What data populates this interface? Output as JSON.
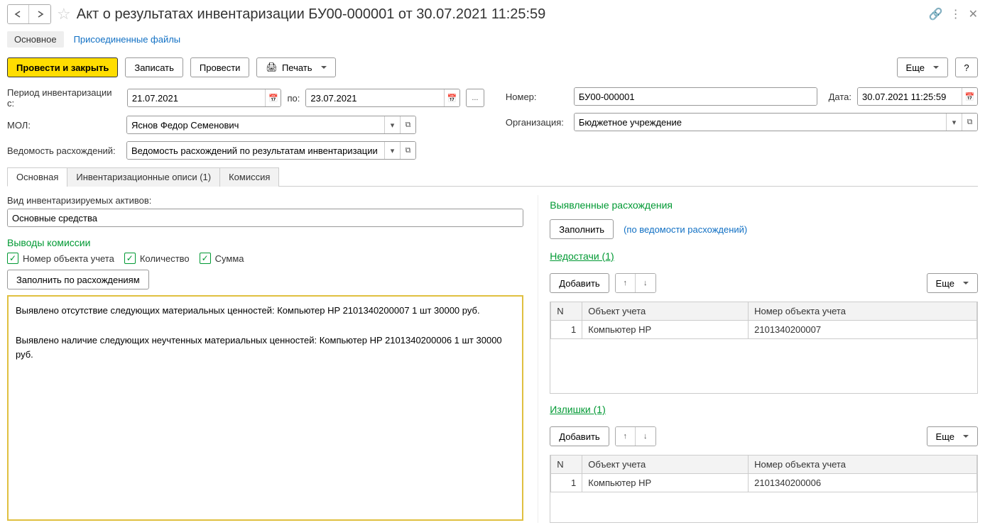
{
  "titlebar": {
    "title": "Акт о результатах инвентаризации БУ00-000001 от 30.07.2021 11:25:59"
  },
  "sections": {
    "main": "Основное",
    "attached": "Присоединенные файлы"
  },
  "toolbar": {
    "post_close": "Провести и закрыть",
    "save": "Записать",
    "post": "Провести",
    "print": "Печать",
    "more": "Еще",
    "help": "?"
  },
  "form": {
    "period_label": "Период инвентаризации с:",
    "period_from": "21.07.2021",
    "period_to_label": "по:",
    "period_to": "23.07.2021",
    "ellipsis": "...",
    "number_label": "Номер:",
    "number": "БУ00-000001",
    "date_label": "Дата:",
    "date": "30.07.2021 11:25:59",
    "mol_label": "МОЛ:",
    "mol": "Яснов Федор Семенович",
    "org_label": "Организация:",
    "org": "Бюджетное учреждение",
    "ved_label": "Ведомость расхождений:",
    "ved": "Ведомость расхождений по результатам инвентаризации БУ"
  },
  "tabs": {
    "t1": "Основная",
    "t2": "Инвентаризационные описи (1)",
    "t3": "Комиссия"
  },
  "left": {
    "asset_type_label": "Вид инвентаризируемых активов:",
    "asset_type": "Основные средства",
    "conclusions": "Выводы комиссии",
    "chk_num": "Номер объекта учета",
    "chk_qty": "Количество",
    "chk_sum": "Сумма",
    "fill_btn": "Заполнить по расхождениям",
    "textarea": "Выявлено отсутствие следующих материальных ценностей: Компьютер HP 2101340200007 1 шт 30000 руб.\n\nВыявлено наличие следующих неучтенных материальных ценностей: Компьютер HP 2101340200006 1 шт 30000 руб."
  },
  "right": {
    "disc_title": "Выявленные расхождения",
    "fill": "Заполнить",
    "fill_link": "(по ведомости расхождений)",
    "shortages": "Недостачи (1)",
    "surpluses": "Излишки (1)",
    "add": "Добавить",
    "more": "Еще",
    "col_n": "N",
    "col_obj": "Объект учета",
    "col_num": "Номер объекта учета",
    "shortages_rows": [
      {
        "n": "1",
        "obj": "Компьютер HP",
        "num": "2101340200007"
      }
    ],
    "surpluses_rows": [
      {
        "n": "1",
        "obj": "Компьютер HP",
        "num": "2101340200006"
      }
    ]
  }
}
